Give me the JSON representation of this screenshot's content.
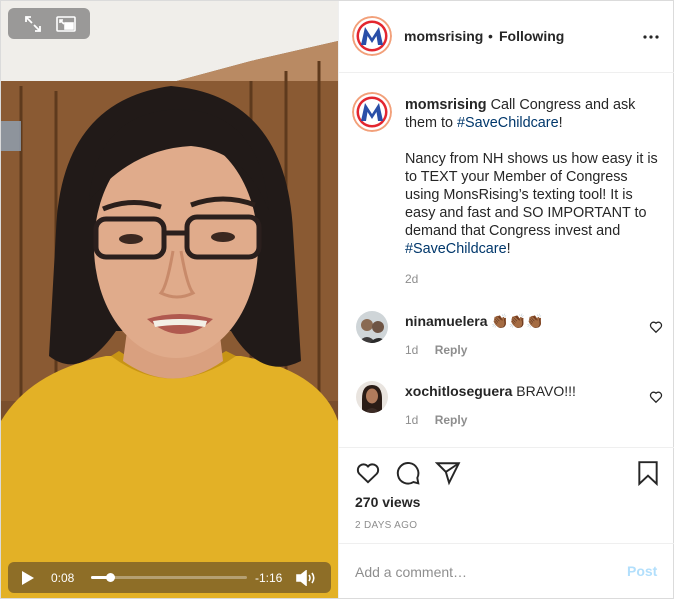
{
  "video": {
    "current_time": "0:08",
    "remaining_time": "-1:16",
    "progress": 0.12,
    "icons": [
      "fullscreen-icon",
      "picture-in-picture-icon",
      "play-icon",
      "volume-icon"
    ]
  },
  "post": {
    "username": "momsrising",
    "separator": "•",
    "follow_status": "Following",
    "caption_username": "momsrising",
    "caption_part1": "Call Congress and ask them to",
    "caption_tag1": "#SaveChildcare",
    "caption_part2": "!",
    "caption_part3": "Nancy from NH shows us how easy it is to TEXT your Member of Congress using MonsRising’s texting tool! It is easy and fast and SO IMPORTANT to demand that Congress invest and",
    "caption_tag2": "#SaveChildcare",
    "caption_part4": "!",
    "caption_age": "2d"
  },
  "comments": [
    {
      "username": "ninamuelera",
      "text": "👏🏾👏🏾👏🏾",
      "age": "1d",
      "reply_label": "Reply"
    },
    {
      "username": "xochitloseguera",
      "text": "BRAVO!!!",
      "age": "1d",
      "reply_label": "Reply"
    }
  ],
  "stats": {
    "views": "270 views",
    "date": "2 DAYS AGO"
  },
  "composer": {
    "placeholder": "Add a comment…",
    "post_label": "Post"
  },
  "colors": {
    "link": "#00376b",
    "secondary_text": "#8e8e8e",
    "post_disabled": "#b2dffc",
    "brand_red": "#e3262f",
    "brand_blue": "#2a4fa8"
  }
}
